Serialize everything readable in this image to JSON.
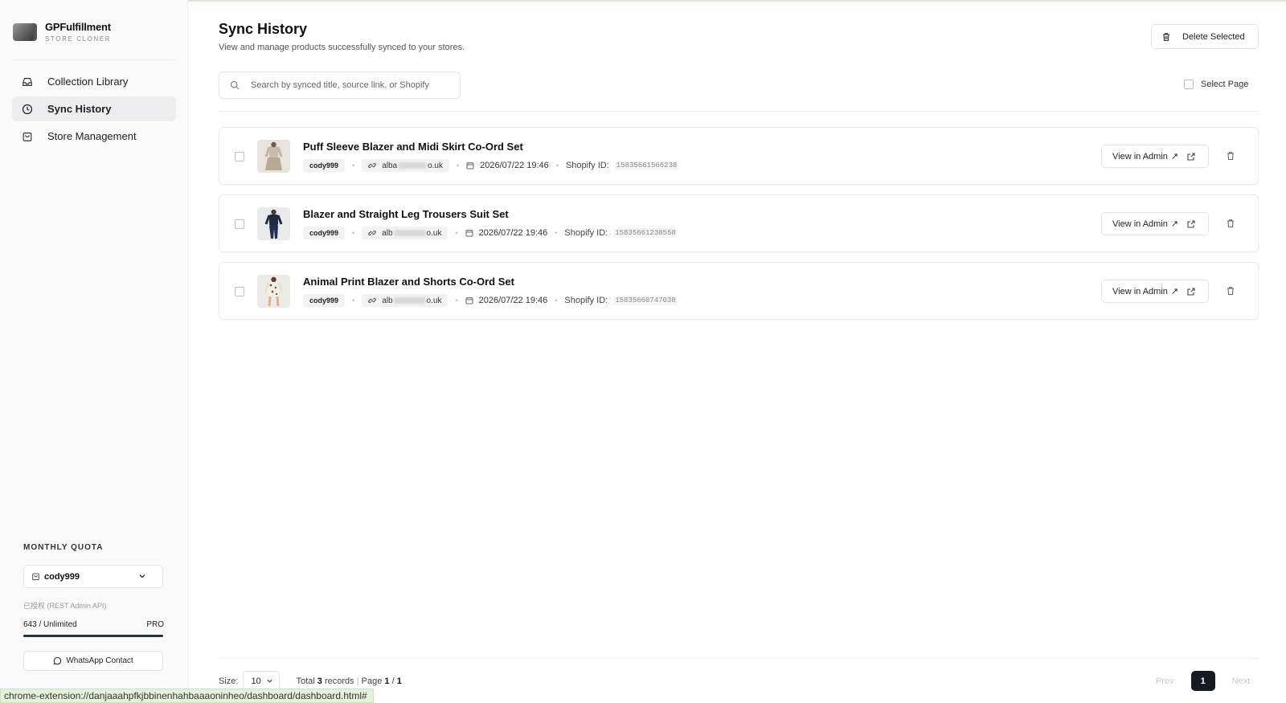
{
  "app": {
    "name": "GPFulfillment",
    "subtitle": "STORE CLONER"
  },
  "sidebar": {
    "items": [
      {
        "label": "Collection Library",
        "icon": "inbox-icon"
      },
      {
        "label": "Sync History",
        "icon": "clock-icon",
        "active": true
      },
      {
        "label": "Store Management",
        "icon": "shopping-bag-icon"
      }
    ]
  },
  "quota": {
    "title": "MONTHLY QUOTA",
    "store": "cody999",
    "auth_text": "已授权 (REST Admin API)",
    "usage": "643 / Unlimited",
    "plan": "PRO",
    "fill": 1.0,
    "whatsapp_label": "WhatsApp Contact"
  },
  "header": {
    "title": "Sync History",
    "subtitle": "View and manage products successfully synced to your stores.",
    "delete_selected": "Delete Selected"
  },
  "search": {
    "placeholder": "Search by synced title, source link, or Shopify",
    "value": ""
  },
  "select_page_label": "Select Page",
  "rows": [
    {
      "title": "Puff Sleeve Blazer and Midi Skirt Co-Ord Set",
      "store": "cody999",
      "link_prefix": "alba",
      "link_suffix": "o.uk",
      "date": "2026/07/22 19:46",
      "shopify_label": "Shopify ID:",
      "shopify_id": "15835661566238",
      "view_label": "View in Admin"
    },
    {
      "title": "Blazer and Straight Leg Trousers Suit Set",
      "store": "cody999",
      "link_prefix": "alb",
      "link_suffix": "o.uk",
      "date": "2026/07/22 19:46",
      "shopify_label": "Shopify ID:",
      "shopify_id": "15835661238558",
      "view_label": "View in Admin"
    },
    {
      "title": "Animal Print Blazer and Shorts Co-Ord Set",
      "store": "cody999",
      "link_prefix": "alb",
      "link_suffix": "o.uk",
      "date": "2026/07/22 19:46",
      "shopify_label": "Shopify ID:",
      "shopify_id": "15835660747038",
      "view_label": "View in Admin"
    }
  ],
  "footer": {
    "size_label": "Size:",
    "size_value": "10",
    "total_prefix": "Total",
    "total_count": "3",
    "records_label": "records",
    "page_label": "Page",
    "page_current": "1",
    "page_total": "1",
    "prev_label": "Prev",
    "next_label": "Next",
    "current_page": "1"
  },
  "statusbar": {
    "url": "chrome-extension://danjaaahpfkjbbinenhahbaaaoninheo/dashboard/dashboard.html#"
  },
  "colors": {
    "accent_dark": "#161a22",
    "active_nav_bg": "#ededef",
    "statusbar_bg": "#e5f2d9"
  }
}
